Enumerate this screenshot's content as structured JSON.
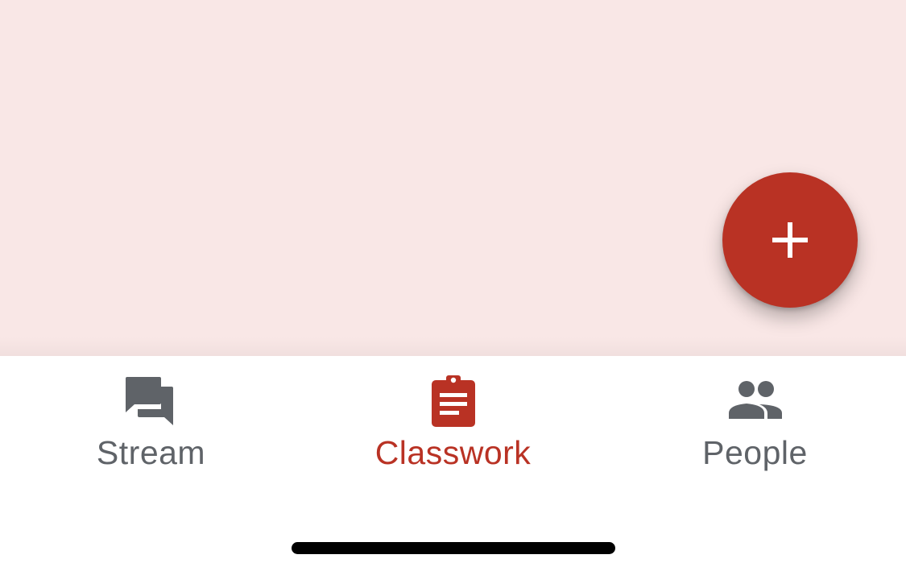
{
  "theme": {
    "accent": "#b93224",
    "content_background": "#f9e7e6",
    "nav_inactive": "#5f6368",
    "nav_background": "#ffffff"
  },
  "fab": {
    "icon": "plus-icon"
  },
  "bottom_nav": {
    "active_tab": "Classwork",
    "items": [
      {
        "label": "Stream",
        "icon": "stream-icon"
      },
      {
        "label": "Classwork",
        "icon": "classwork-icon"
      },
      {
        "label": "People",
        "icon": "people-icon"
      }
    ]
  }
}
